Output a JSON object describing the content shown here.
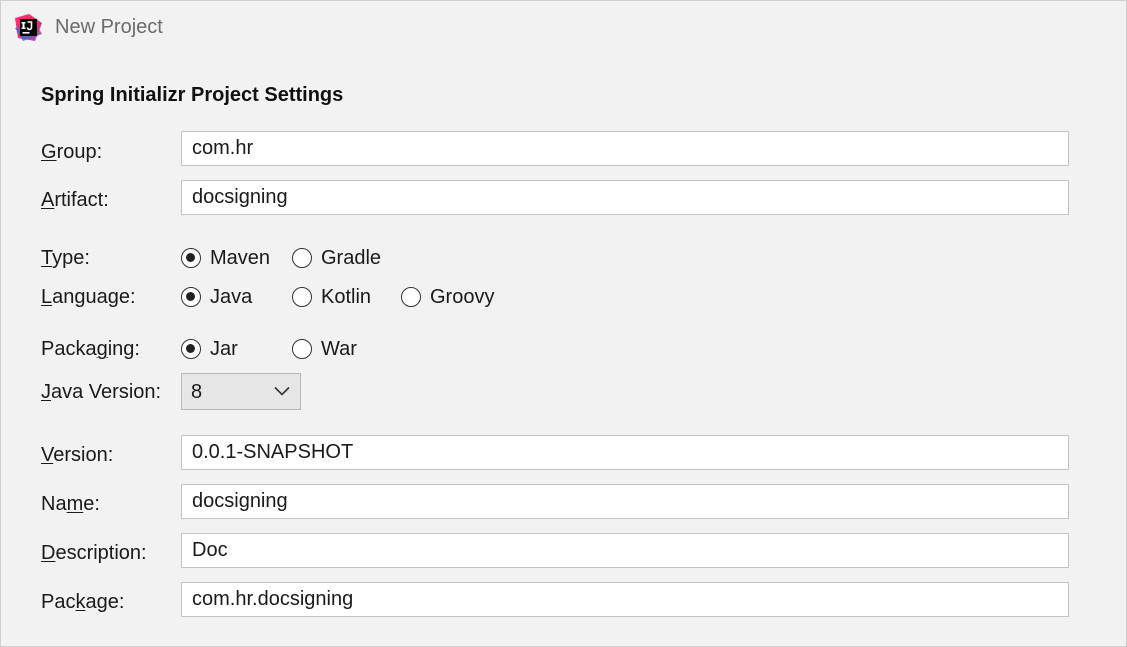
{
  "window": {
    "title": "New Project",
    "app_icon": "intellij-idea-icon"
  },
  "section_title": "Spring Initializr Project Settings",
  "fields": {
    "group": {
      "mnemonic": "G",
      "rest": "roup:",
      "value": "com.hr"
    },
    "artifact": {
      "mnemonic": "A",
      "rest": "rtifact:",
      "value": "docsigning"
    },
    "version": {
      "mnemonic": "V",
      "rest": "ersion:",
      "value": "0.0.1-SNAPSHOT"
    },
    "name": {
      "pre": "Na",
      "mnemonic": "m",
      "rest": "e:",
      "value": "docsigning"
    },
    "description": {
      "mnemonic": "D",
      "rest": "escription:",
      "value": "Doc"
    },
    "package": {
      "pre": "Pac",
      "mnemonic": "k",
      "rest": "age:",
      "value": "com.hr.docsigning"
    }
  },
  "type": {
    "mnemonic": "T",
    "rest": "ype:",
    "options": [
      {
        "label": "Maven",
        "checked": true
      },
      {
        "label": "Gradle",
        "checked": false
      }
    ]
  },
  "language": {
    "mnemonic": "L",
    "rest": "anguage:",
    "options": [
      {
        "label": "Java",
        "checked": true
      },
      {
        "label": "Kotlin",
        "checked": false
      },
      {
        "label": "Groovy",
        "checked": false
      }
    ]
  },
  "packaging": {
    "pre": "Packa",
    "mnemonic": "g",
    "rest": "ing:",
    "options": [
      {
        "label": "Jar",
        "checked": true
      },
      {
        "label": "War",
        "checked": false
      }
    ]
  },
  "java_version": {
    "mnemonic": "J",
    "rest": "ava Version:",
    "selected": "8",
    "icon": "chevron-down-icon"
  }
}
